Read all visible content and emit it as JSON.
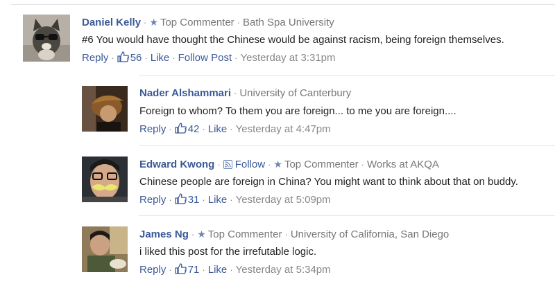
{
  "comments": [
    {
      "name": "Daniel Kelly",
      "badge": "Top Commenter",
      "affiliation": "Bath Spa University",
      "text": "#6 You would have thought the Chinese would be against racism, being foreign themselves.",
      "reply": "Reply",
      "likes": "56",
      "like": "Like",
      "follow_post": "Follow Post",
      "time": "Yesterday at 3:31pm"
    },
    {
      "name": "Nader Alshammari",
      "affiliation": "University of Canterbury",
      "text": "Foreign to whom? To them you are foreign... to me you are foreign....",
      "reply": "Reply",
      "likes": "42",
      "like": "Like",
      "time": "Yesterday at 4:47pm"
    },
    {
      "name": "Edward Kwong",
      "follow": "Follow",
      "badge": "Top Commenter",
      "affiliation": "Works at AKQA",
      "text": "Chinese people are foreign in China? You might want to think about that on buddy.",
      "reply": "Reply",
      "likes": "31",
      "like": "Like",
      "time": "Yesterday at 5:09pm"
    },
    {
      "name": "James Ng",
      "badge": "Top Commenter",
      "affiliation": "University of California, San Diego",
      "text": "i liked this post for the irrefutable logic.",
      "reply": "Reply",
      "likes": "71",
      "like": "Like",
      "time": "Yesterday at 5:34pm"
    }
  ],
  "icons": {
    "like": "thumbs-up-icon",
    "star": "star-icon",
    "follow": "rss-icon"
  }
}
